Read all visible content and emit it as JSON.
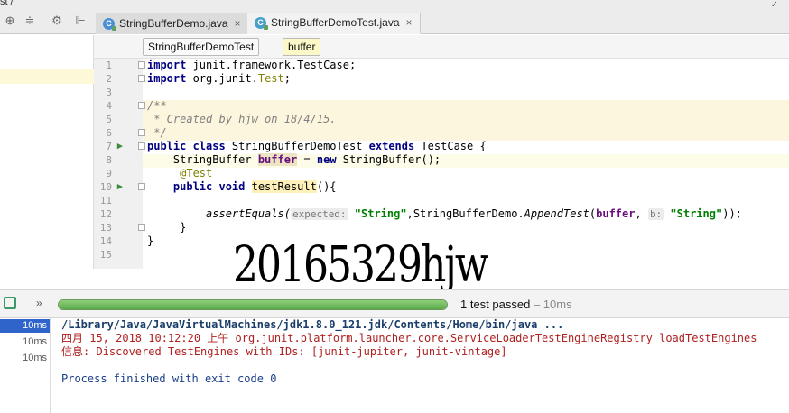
{
  "toolbar": {
    "crumb": "st /",
    "icons": [
      "add-icon",
      "collapse-icon",
      "gear-icon",
      "pin-icon"
    ]
  },
  "tabs": [
    {
      "label": "StringBufferDemo.java",
      "active": false
    },
    {
      "label": "StringBufferDemoTest.java",
      "active": true
    }
  ],
  "breadcrumb": {
    "class_name": "StringBufferDemoTest",
    "field_name": "buffer"
  },
  "editor": {
    "line_numbers": [
      "1",
      "2",
      "3",
      "4",
      "5",
      "6",
      "7",
      "8",
      "9",
      "10",
      "11",
      "12",
      "13",
      "14",
      "15"
    ],
    "lines": {
      "l1_kw": "import",
      "l1_rest": " junit.framework.TestCase;",
      "l2_kw": "import",
      "l2_rest": " org.junit.",
      "l2_cls": "Test",
      "l2_end": ";",
      "l4": "/**",
      "l5": " * Created by hjw on 18/4/15.",
      "l6": " */",
      "l7_kw1": "public class",
      "l7_name": " StringBufferDemoTest ",
      "l7_kw2": "extends",
      "l7_end": " TestCase {",
      "l8_type": "    StringBuffer ",
      "l8_field": "buffer",
      "l8_mid": " = ",
      "l8_kw": "new",
      "l8_end": " StringBuffer();",
      "l9": "     @Test",
      "l10_kw": "    public void",
      "l10_sp": " ",
      "l10_method": "testResult",
      "l10_end": "(){",
      "l12_call": "         assertEquals(",
      "l12_hint1": "expected:",
      "l12_str1": " \"String\"",
      "l12_mid": ",StringBufferDemo.",
      "l12_call2": "AppendTest",
      "l12_open": "(",
      "l12_field": "buffer",
      "l12_comma": ", ",
      "l12_hint2": "b:",
      "l12_str2": " \"String\"",
      "l12_end": "));",
      "l13": "     }",
      "l14": "}"
    }
  },
  "watermark": "20165329hjw",
  "run": {
    "more": "»",
    "progress_fraction": 1.0,
    "status": "1 test passed",
    "duration": " – 10ms",
    "tree_times": [
      "10ms",
      "10ms",
      "10ms"
    ],
    "console": [
      "/Library/Java/JavaVirtualMachines/jdk1.8.0_121.jdk/Contents/Home/bin/java ...",
      "四月 15, 2018 10:12:20 上午 org.junit.platform.launcher.core.ServiceLoaderTestEngineRegistry loadTestEngines",
      "信息: Discovered TestEngines with IDs: [junit-jupiter, junit-vintage]",
      "Process finished with exit code 0"
    ]
  },
  "colors": {
    "keyword": "#000080",
    "string": "#008000",
    "selection": "#2f65ca",
    "progress": "#5aa84a"
  }
}
